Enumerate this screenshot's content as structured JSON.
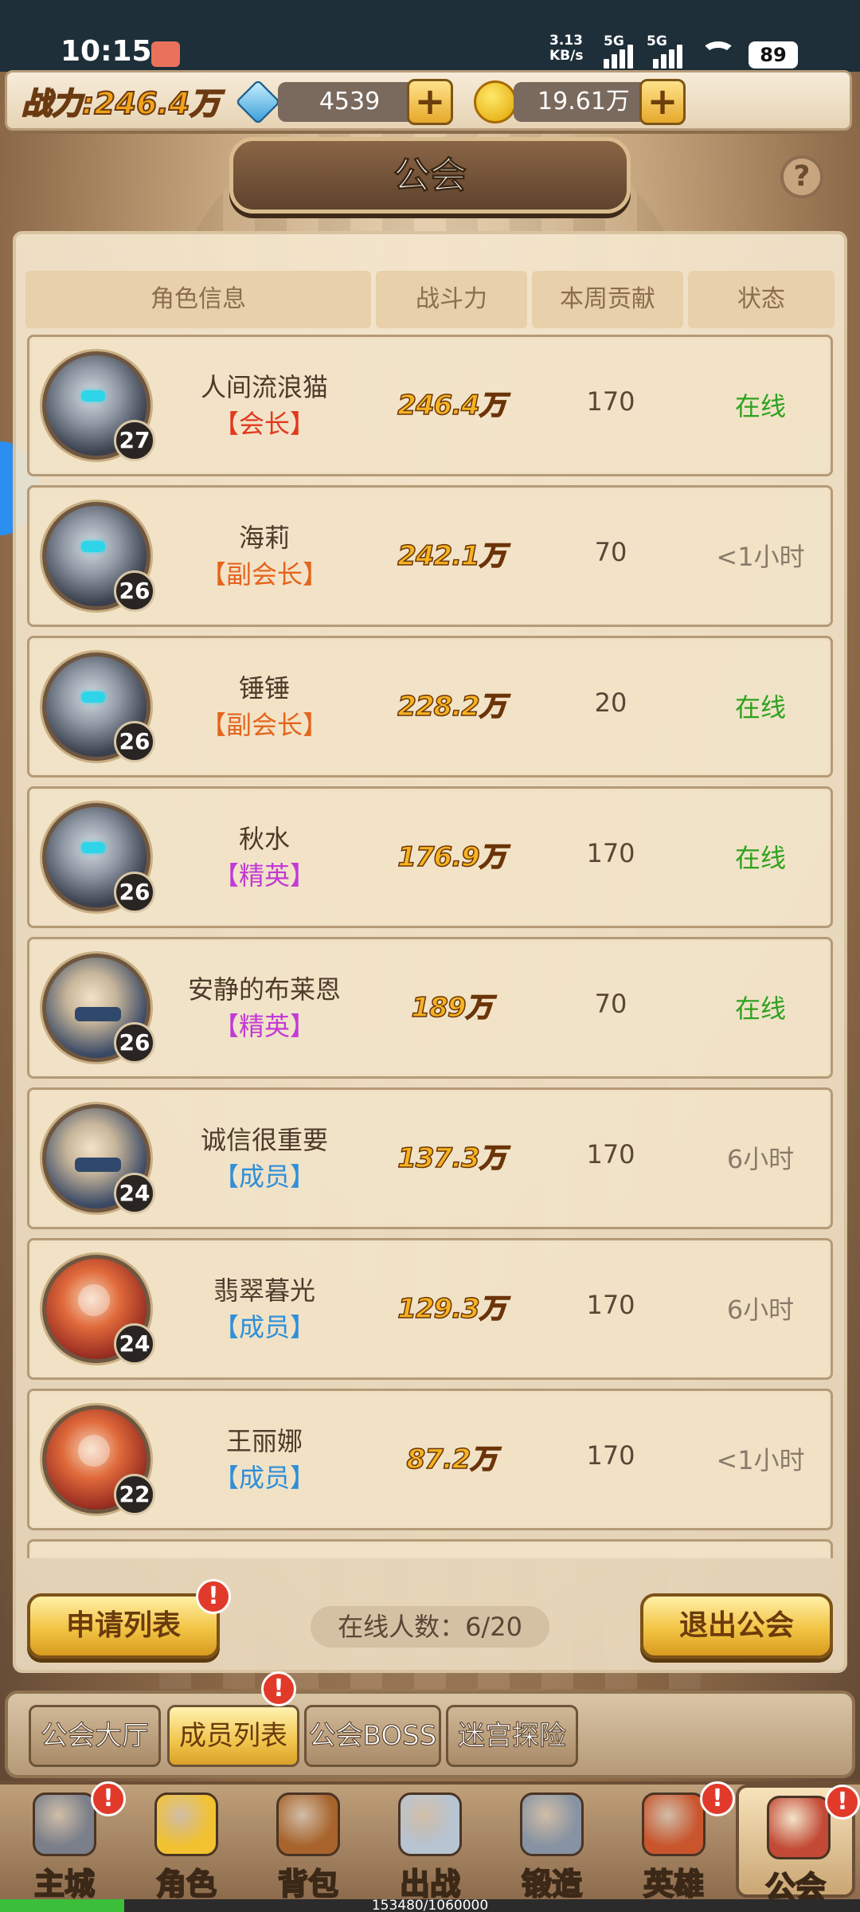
{
  "status_bar": {
    "time": "10:15",
    "net_speed_1": "3.13",
    "net_speed_2": "KB/s",
    "signal1": "5G",
    "signal2": "5G",
    "battery": "89"
  },
  "top_bar": {
    "power_label": "战力:246.4万",
    "gems": "4539",
    "gold": "19.61万",
    "plus": "+"
  },
  "title": "公会",
  "help": "?",
  "table": {
    "headers": [
      "角色信息",
      "战斗力",
      "本周贡献",
      "状态"
    ],
    "rows": [
      {
        "name": "人间流浪猫",
        "role": "【会长】",
        "role_color": "#e23a1f",
        "level": "27",
        "power": "246.4万",
        "contribution": "170",
        "status": "在线",
        "online": true,
        "avatar": "knight-dark"
      },
      {
        "name": "海莉",
        "role": "【副会长】",
        "role_color": "#e5641e",
        "level": "26",
        "power": "242.1万",
        "contribution": "70",
        "status": "<1小时",
        "online": false,
        "avatar": "knight-dark"
      },
      {
        "name": "锤锤",
        "role": "【副会长】",
        "role_color": "#e5641e",
        "level": "26",
        "power": "228.2万",
        "contribution": "20",
        "status": "在线",
        "online": true,
        "avatar": "knight-dark"
      },
      {
        "name": "秋水",
        "role": "【精英】",
        "role_color": "#c23ad8",
        "level": "26",
        "power": "176.9万",
        "contribution": "170",
        "status": "在线",
        "online": true,
        "avatar": "knight-dark"
      },
      {
        "name": "安静的布莱恩",
        "role": "【精英】",
        "role_color": "#c23ad8",
        "level": "26",
        "power": "189万",
        "contribution": "70",
        "status": "在线",
        "online": true,
        "avatar": "ninja"
      },
      {
        "name": "诚信很重要",
        "role": "【成员】",
        "role_color": "#2f8fd8",
        "level": "24",
        "power": "137.3万",
        "contribution": "170",
        "status": "6小时",
        "online": false,
        "avatar": "ninja"
      },
      {
        "name": "翡翠暮光",
        "role": "【成员】",
        "role_color": "#2f8fd8",
        "level": "24",
        "power": "129.3万",
        "contribution": "170",
        "status": "6小时",
        "online": false,
        "avatar": "warrior-red"
      },
      {
        "name": "王丽娜",
        "role": "【成员】",
        "role_color": "#2f8fd8",
        "level": "22",
        "power": "87.2万",
        "contribution": "170",
        "status": "<1小时",
        "online": false,
        "avatar": "warrior-red"
      }
    ]
  },
  "footer": {
    "apply_list": "申请列表",
    "online_count": "在线人数：6/20",
    "leave_guild": "退出公会",
    "badge": "!"
  },
  "subtabs": [
    "公会大厅",
    "成员列表",
    "公会BOSS",
    "迷宫探险"
  ],
  "bottom_nav": [
    {
      "label": "主城",
      "badge": true,
      "icon": "castle-icon",
      "color": "#7a7f8a"
    },
    {
      "label": "角色",
      "badge": false,
      "icon": "crown-icon",
      "color": "#f2c230"
    },
    {
      "label": "背包",
      "badge": false,
      "icon": "backpack-icon",
      "color": "#a8642c"
    },
    {
      "label": "出战",
      "badge": false,
      "icon": "swords-icon",
      "color": "#b7c4d2"
    },
    {
      "label": "锻造",
      "badge": false,
      "icon": "hammer-icon",
      "color": "#8793a2"
    },
    {
      "label": "英雄",
      "badge": true,
      "icon": "hero-emblem-icon",
      "color": "#c9552d"
    },
    {
      "label": "公会",
      "badge": true,
      "icon": "guild-shield-icon",
      "color": "#c34a36"
    }
  ],
  "exp": {
    "text": "153480/1060000",
    "current": 153480,
    "max": 1060000
  },
  "colors": {
    "online": "#2fa21f",
    "offline": "#8a7a6a",
    "accent_gold": "#f5b321"
  }
}
